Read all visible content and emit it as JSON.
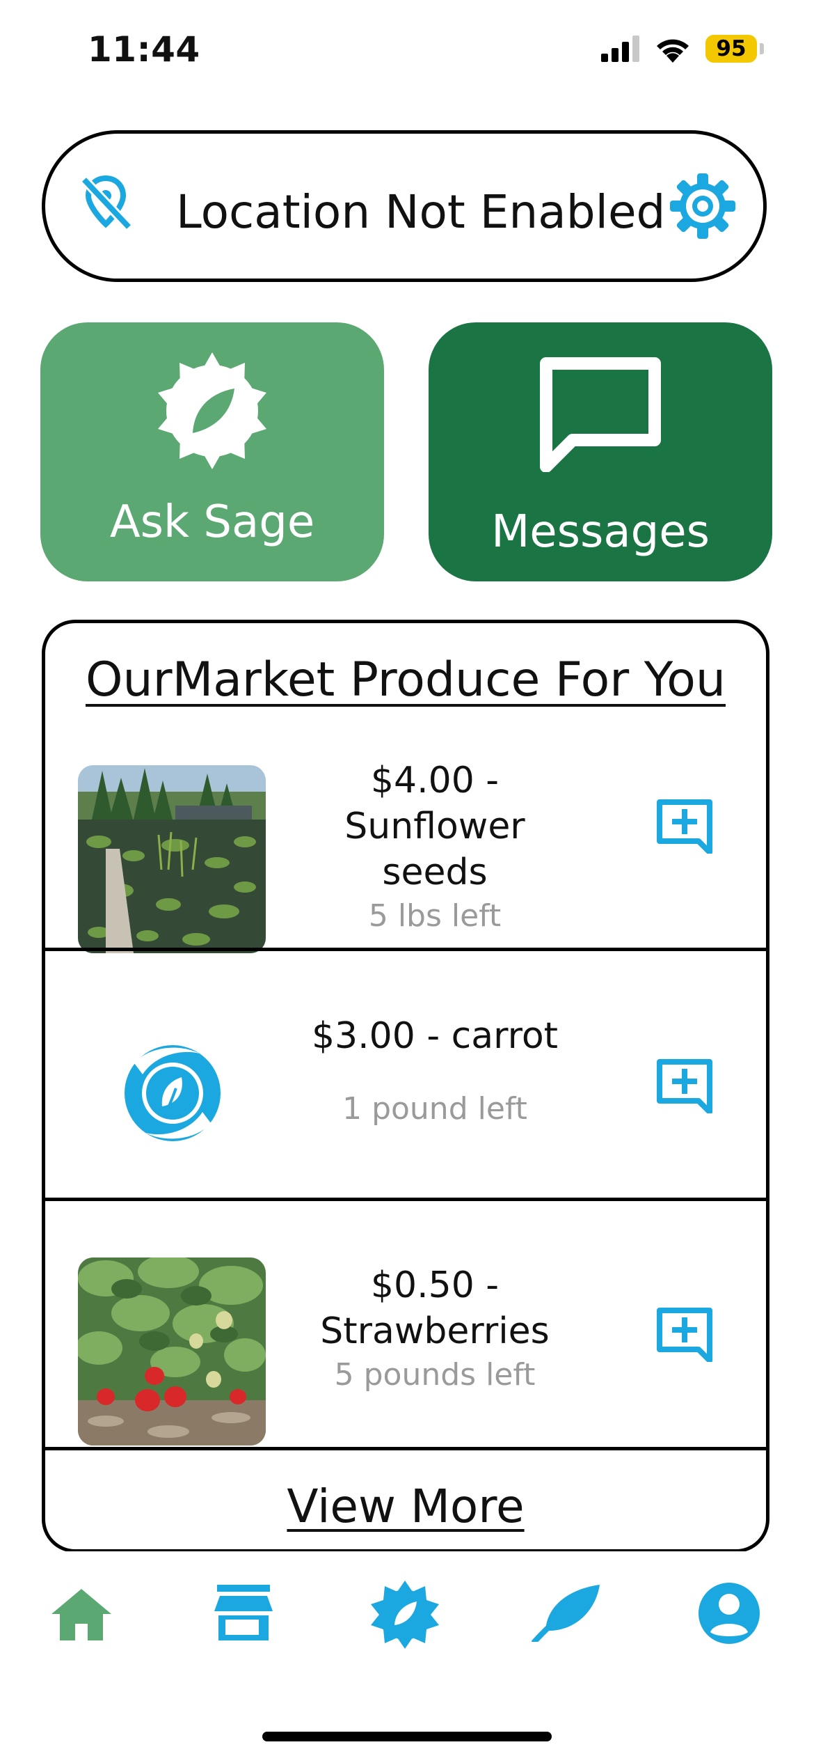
{
  "status_bar": {
    "time": "11:44",
    "battery": "95"
  },
  "location": {
    "text": "Location Not Enabled"
  },
  "tiles": {
    "ask_sage": "Ask Sage",
    "messages": "Messages"
  },
  "produce": {
    "title": "OurMarket Produce For You",
    "items": [
      {
        "price_name": "$4.00 - Sunflower seeds",
        "quantity": "5 lbs left"
      },
      {
        "price_name": "$3.00 - carrot",
        "quantity": "1 pound left"
      },
      {
        "price_name": "$0.50 - Strawberries",
        "quantity": "5 pounds left"
      }
    ],
    "view_more": "View More"
  },
  "nav": {
    "items": [
      "home-icon",
      "store-icon",
      "compass-icon",
      "leaf-icon",
      "profile-icon"
    ]
  },
  "colors": {
    "accent_blue": "#1ba8e0",
    "sage_green": "#5ba873",
    "dark_green": "#1a7444",
    "home_green": "#5ba873"
  }
}
